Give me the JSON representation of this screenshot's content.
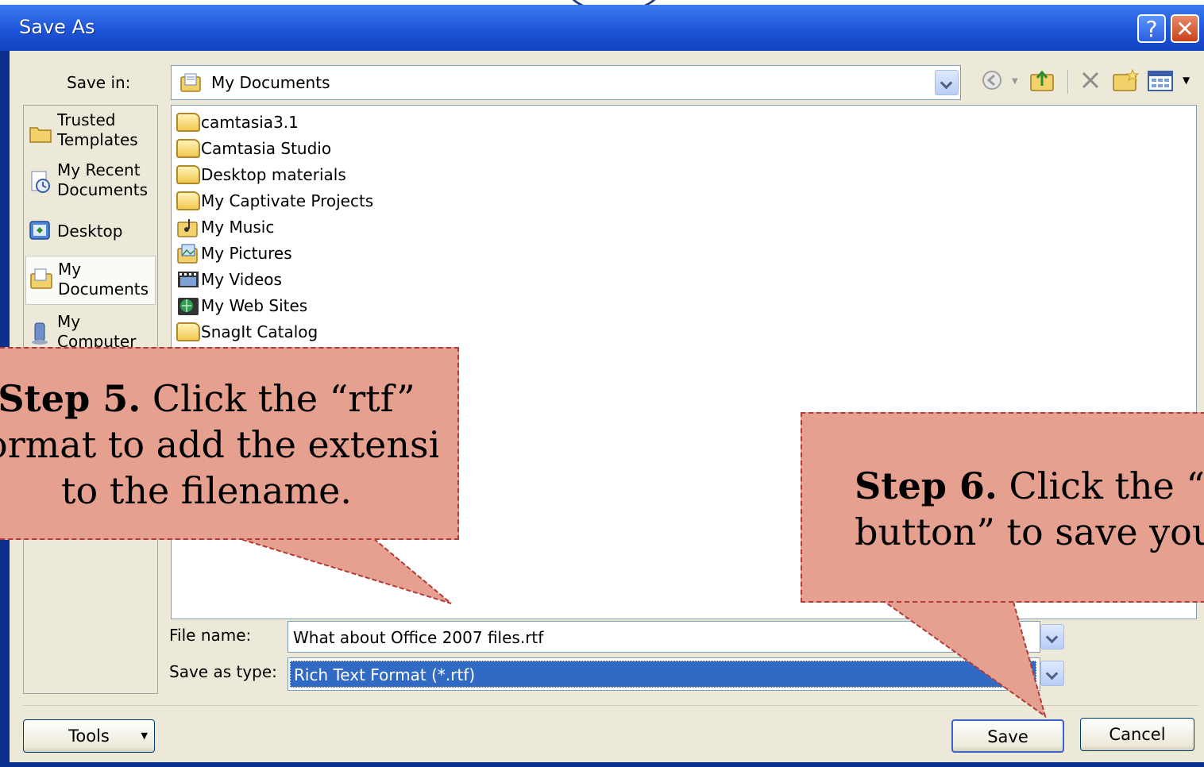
{
  "dialog": {
    "title": "Save As",
    "help_label": "?",
    "close_label": "✕"
  },
  "save_in": {
    "label": "Save in:",
    "value": "My Documents"
  },
  "places": [
    {
      "label_line1": "Trusted",
      "label_line2": "Templates",
      "icon": "folder-icon"
    },
    {
      "label_line1": "My Recent",
      "label_line2": "Documents",
      "icon": "recent-documents-icon"
    },
    {
      "label_line1": "Desktop",
      "label_line2": "",
      "icon": "desktop-icon"
    },
    {
      "label_line1": "My",
      "label_line2": "Documents",
      "icon": "my-documents-icon"
    },
    {
      "label_line1": "My",
      "label_line2": "Computer",
      "icon": "my-computer-icon"
    }
  ],
  "files": [
    {
      "name": "camtasia3.1",
      "icon": "folder-icon"
    },
    {
      "name": "Camtasia Studio",
      "icon": "folder-icon"
    },
    {
      "name": "Desktop materials",
      "icon": "folder-icon"
    },
    {
      "name": "My Captivate Projects",
      "icon": "folder-icon"
    },
    {
      "name": "My Music",
      "icon": "music-folder-icon"
    },
    {
      "name": "My Pictures",
      "icon": "pictures-folder-icon"
    },
    {
      "name": "My Videos",
      "icon": "videos-folder-icon"
    },
    {
      "name": "My Web Sites",
      "icon": "web-folder-icon"
    },
    {
      "name": "SnagIt Catalog",
      "icon": "folder-icon"
    }
  ],
  "file_name": {
    "label": "File name:",
    "value": "What about Office 2007 files.rtf"
  },
  "save_as_type": {
    "label": "Save as type:",
    "value": "Rich Text Format (*.rtf)"
  },
  "buttons": {
    "tools": "Tools",
    "save": "Save",
    "cancel": "Cancel"
  },
  "callouts": {
    "step5_bold": "Step 5.",
    "step5_line1_rest": " Click  the “rtf”",
    "step5_line2": "ormat to add the extension",
    "step5_line3": "to the filename.",
    "step6_bold": "Step 6.",
    "step6_line1_rest": " Click  the “Sa",
    "step6_line2": "button” to save your"
  },
  "colors": {
    "titlebar": "#1d54d8",
    "dialog_bg": "#ece9d8",
    "callout_bg": "#e5a08f",
    "callout_border": "#b43a3a",
    "selection": "#316ac5"
  }
}
